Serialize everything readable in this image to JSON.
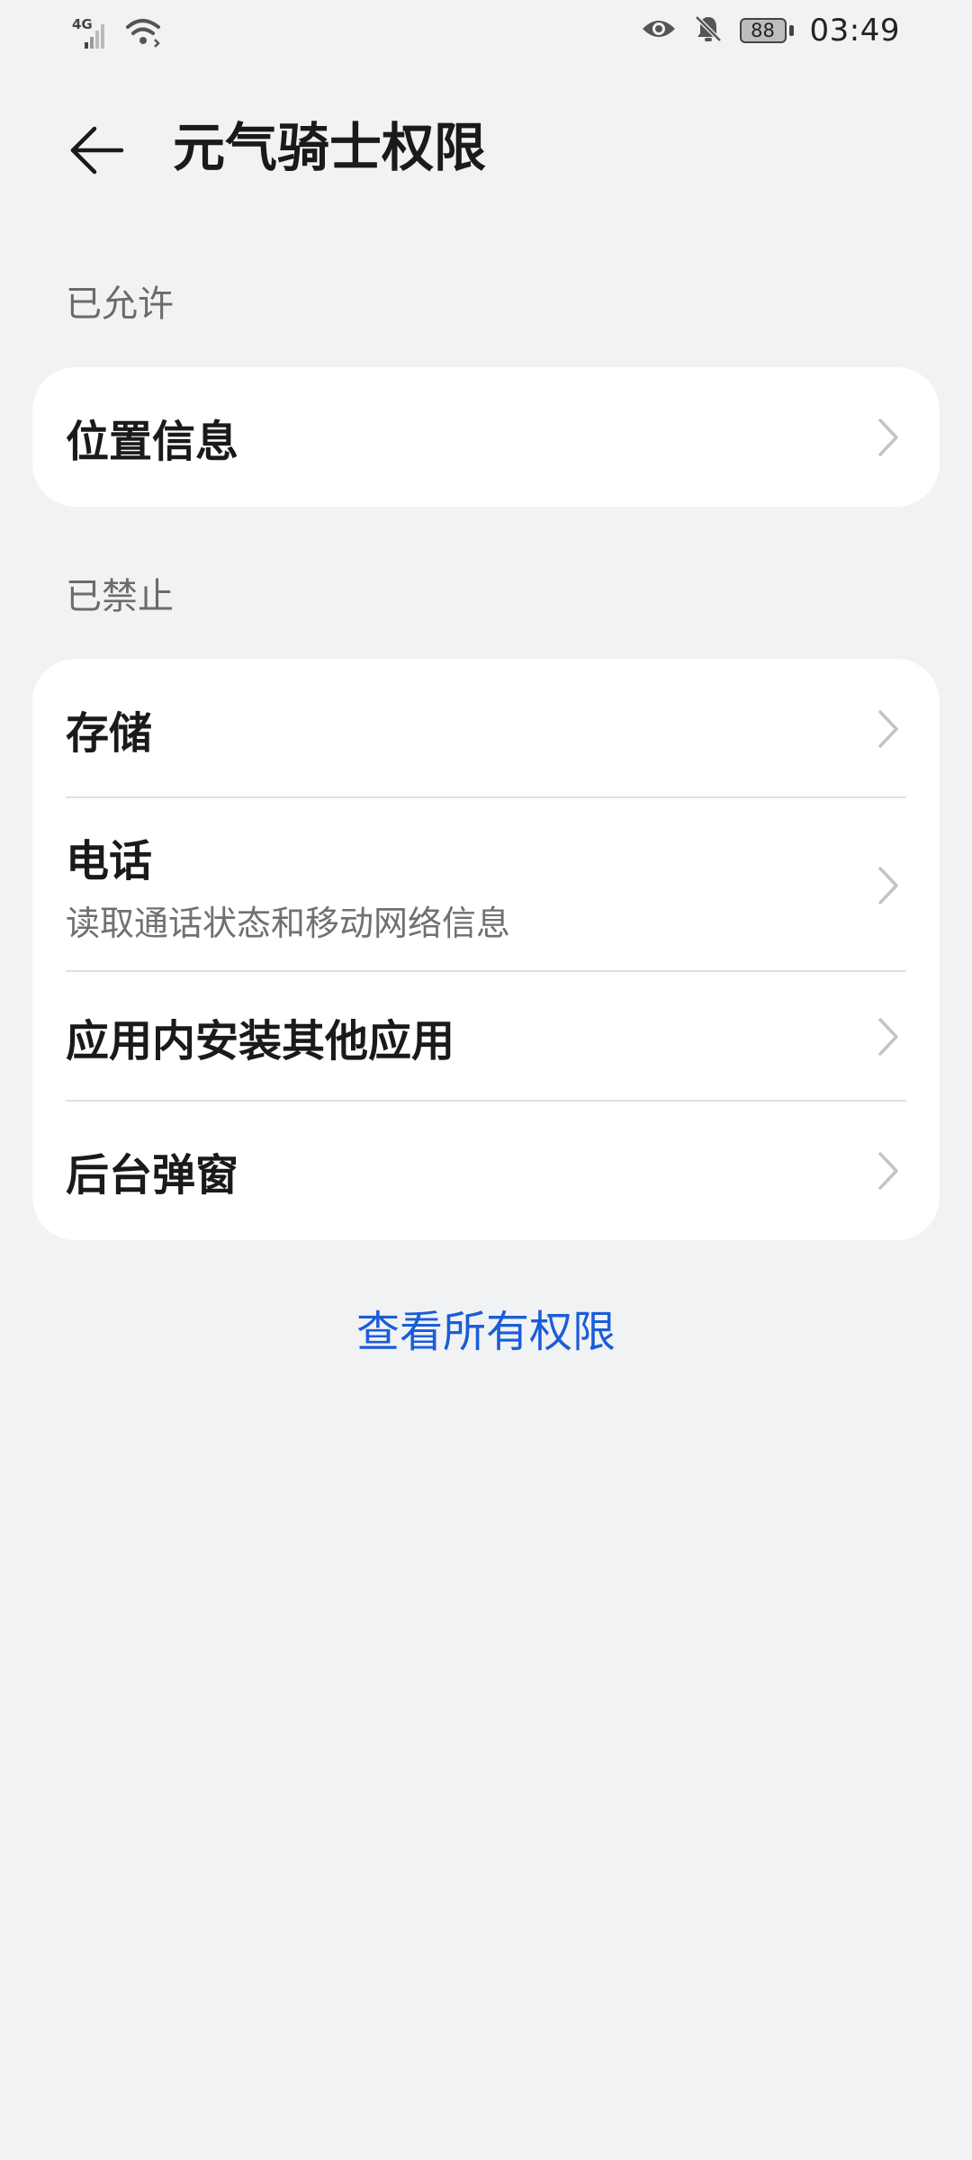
{
  "status_bar": {
    "network": "4G",
    "battery": "88",
    "time": "03:49"
  },
  "header": {
    "title": "元气骑士权限"
  },
  "sections": {
    "allowed": {
      "title": "已允许",
      "items": [
        {
          "label": "位置信息"
        }
      ]
    },
    "denied": {
      "title": "已禁止",
      "items": [
        {
          "label": "存储"
        },
        {
          "label": "电话",
          "sub": "读取通话状态和移动网络信息"
        },
        {
          "label": "应用内安装其他应用"
        },
        {
          "label": "后台弹窗"
        }
      ]
    }
  },
  "view_all": "查看所有权限",
  "colors": {
    "background": "#f1f2f4",
    "card": "#ffffff",
    "accent": "#1a5dd8",
    "secondary_text": "#6b6b6b"
  }
}
